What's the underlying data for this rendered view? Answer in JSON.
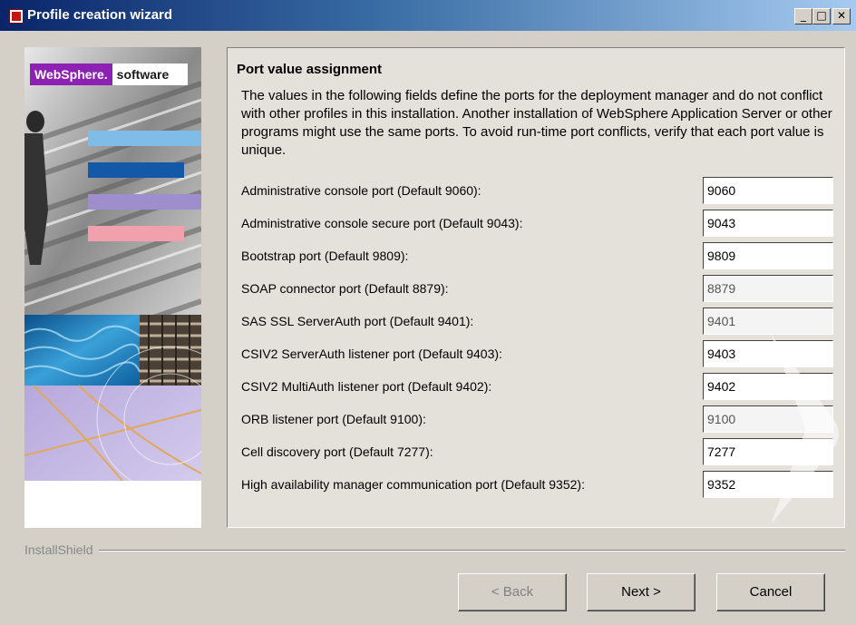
{
  "window": {
    "title": "Profile creation wizard",
    "controls": {
      "minimize": "_",
      "maximize": "□",
      "close": "✕"
    }
  },
  "banner": {
    "brand": "WebSphere.",
    "subtitle": "software"
  },
  "content": {
    "heading": "Port value assignment",
    "description": "The values in the following fields define the ports for the deployment manager and do not conflict with other profiles in this installation. Another installation of WebSphere Application Server or other programs might use the same ports. To avoid run-time port conflicts, verify that each port value is unique.",
    "ports": [
      {
        "label": "Administrative console port (Default 9060):",
        "value": "9060",
        "editable": true
      },
      {
        "label": "Administrative console secure port (Default 9043):",
        "value": "9043",
        "editable": true
      },
      {
        "label": "Bootstrap port (Default 9809):",
        "value": "9809",
        "editable": true
      },
      {
        "label": "SOAP connector port (Default 8879):",
        "value": "8879",
        "editable": false
      },
      {
        "label": "SAS SSL ServerAuth port (Default 9401):",
        "value": "9401",
        "editable": false
      },
      {
        "label": "CSIV2 ServerAuth listener port (Default 9403):",
        "value": "9403",
        "editable": true
      },
      {
        "label": "CSIV2 MultiAuth listener port (Default 9402):",
        "value": "9402",
        "editable": true
      },
      {
        "label": "ORB listener port (Default 9100):",
        "value": "9100",
        "editable": false
      },
      {
        "label": "Cell discovery port (Default 7277):",
        "value": "7277",
        "editable": true
      },
      {
        "label": "High availability manager communication port (Default 9352):",
        "value": "9352",
        "editable": true
      }
    ]
  },
  "footer": {
    "installshield": "InstallShield",
    "back_label": "< Back",
    "next_label": "Next >",
    "cancel_label": "Cancel"
  },
  "colors": {
    "title_gradient_start": "#0a246a",
    "title_gradient_end": "#a6caf0",
    "websphere_purple": "#8c21b3",
    "window_bg": "#d4d0c8"
  }
}
